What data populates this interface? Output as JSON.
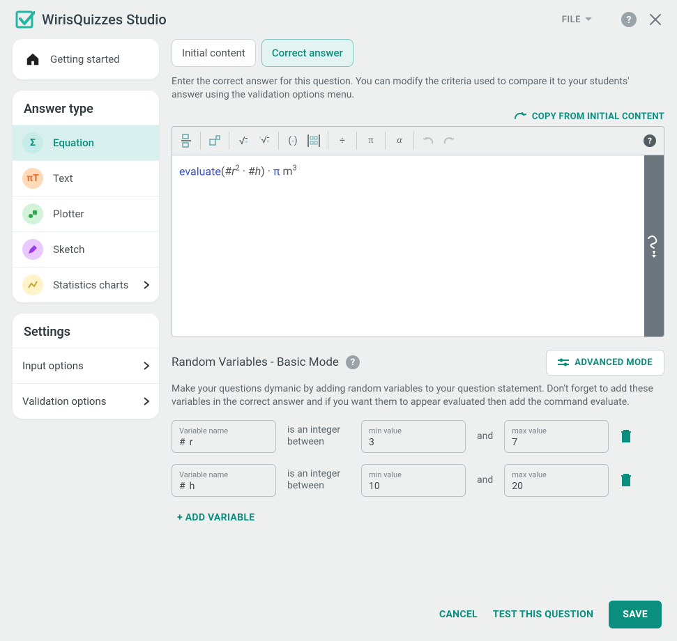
{
  "header": {
    "title": "WirisQuizzes Studio",
    "file_label": "FILE"
  },
  "sidebar": {
    "getting_started": "Getting started",
    "answer_type_title": "Answer type",
    "types": [
      {
        "label": "Equation",
        "sym": "Σ"
      },
      {
        "label": "Text",
        "sym": "πT"
      },
      {
        "label": "Plotter",
        "sym": ""
      },
      {
        "label": "Sketch",
        "sym": ""
      },
      {
        "label": "Statistics charts",
        "sym": ""
      }
    ],
    "settings_title": "Settings",
    "settings": [
      {
        "label": "Input options"
      },
      {
        "label": "Validation options"
      }
    ]
  },
  "tabs": {
    "initial": "Initial content",
    "correct": "Correct answer"
  },
  "description": "Enter the correct answer for this question. You can modify the criteria used to compare it to your students' answer using the validation options menu.",
  "copy_label": "COPY FROM INITIAL CONTENT",
  "editor": {
    "formula_fn": "evaluate",
    "formula_body": "(#r² · #h) · π m³"
  },
  "random": {
    "title": "Random Variables - Basic Mode",
    "advanced": "ADVANCED MODE",
    "desc": "Make your questions dymanic by adding random variables to your question statement. Don't forget to add these variables in the correct answer and if you want them to appear evaluated then add the command evaluate.",
    "var_label": "Variable name",
    "min_label": "min value",
    "max_label": "max value",
    "between": "is an integer between",
    "and": "and",
    "vars": [
      {
        "name": "r",
        "min": "3",
        "max": "7"
      },
      {
        "name": "h",
        "min": "10",
        "max": "20"
      }
    ],
    "add_label": "+ ADD VARIABLE"
  },
  "footer": {
    "cancel": "CANCEL",
    "test": "TEST THIS QUESTION",
    "save": "SAVE"
  }
}
